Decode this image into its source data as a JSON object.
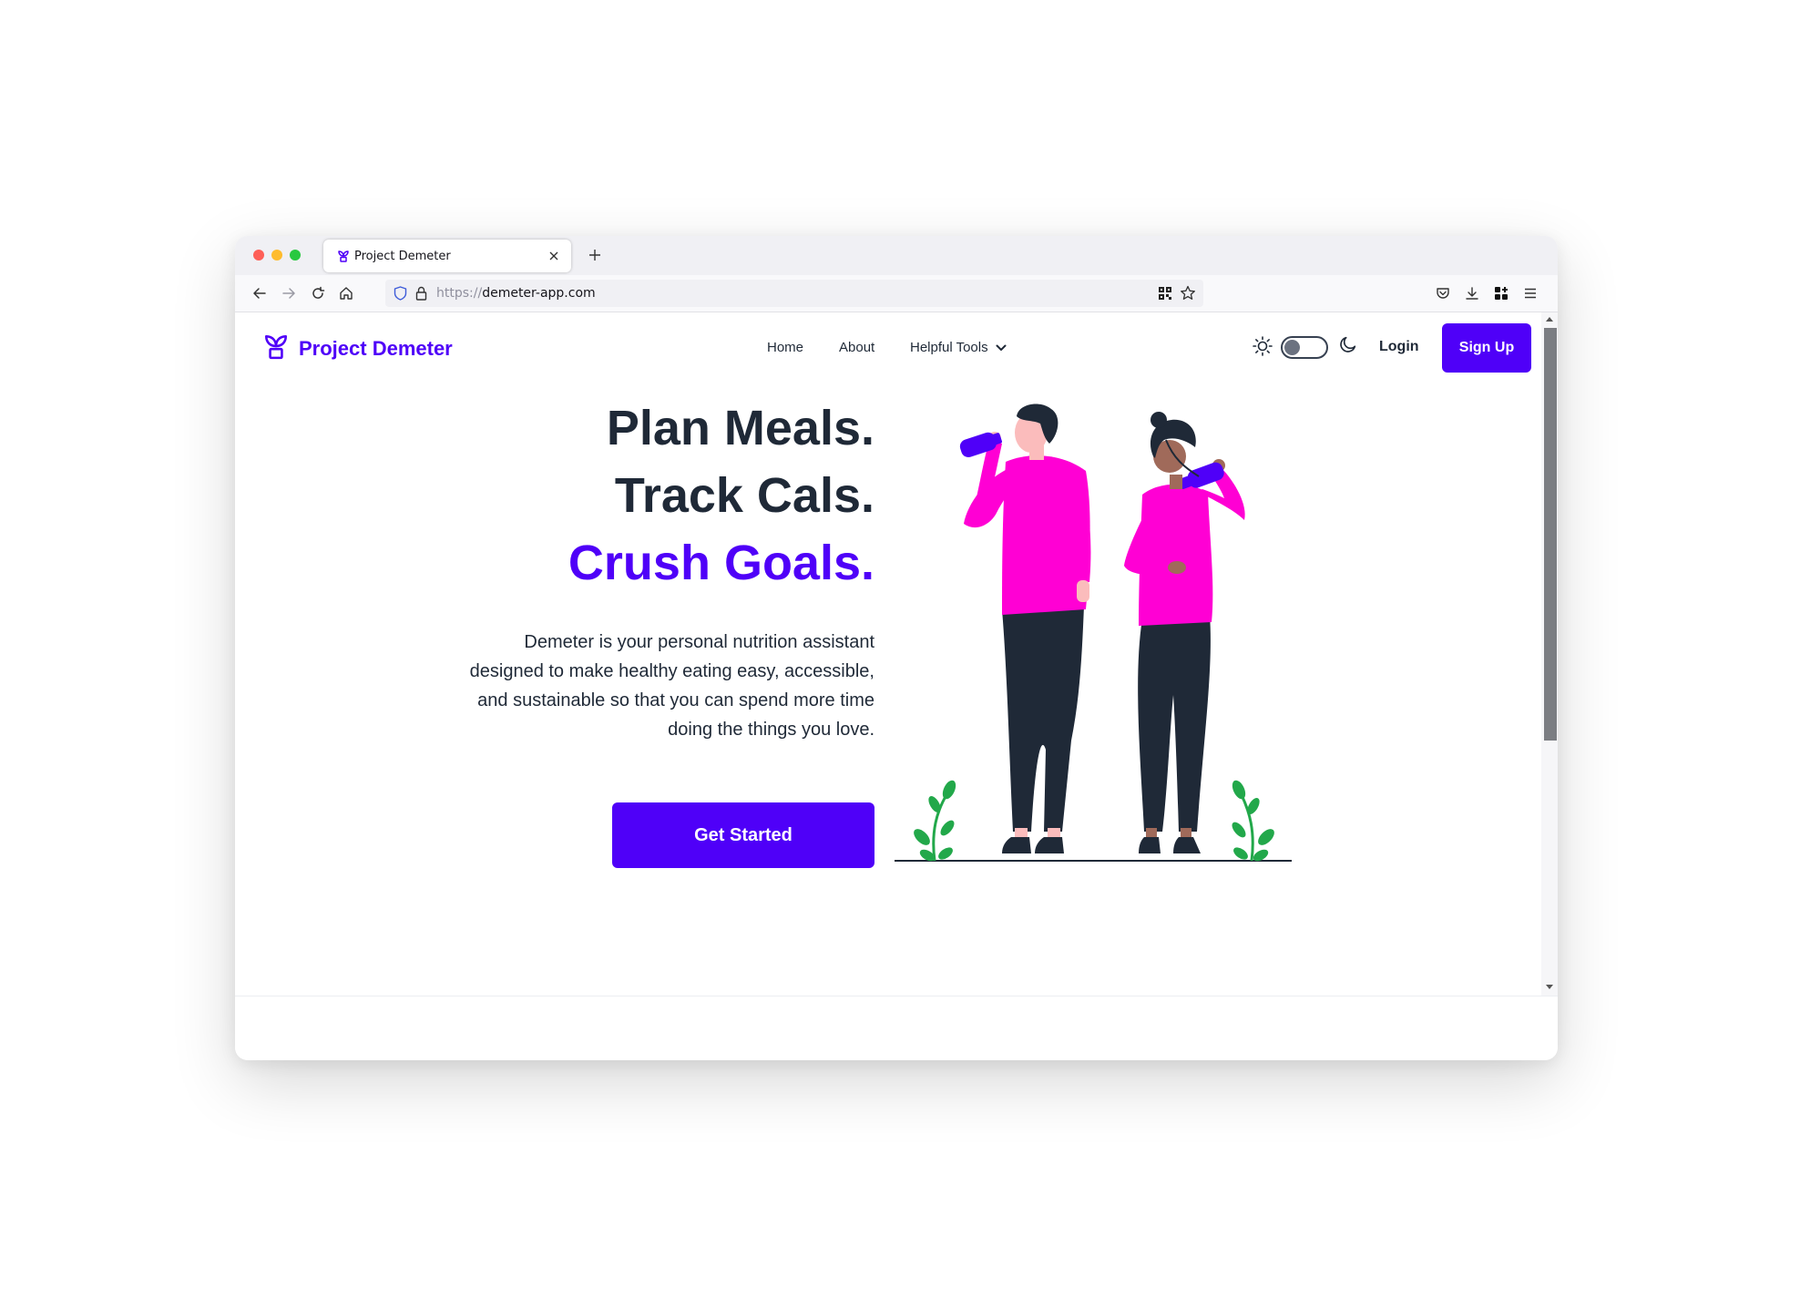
{
  "browser": {
    "tab_title": "Project Demeter",
    "url_scheme": "https://",
    "url_host": "demeter-app.com",
    "new_tab_label": "+"
  },
  "site": {
    "brand": "Project Demeter",
    "nav": {
      "home": "Home",
      "about": "About",
      "tools": "Helpful Tools"
    },
    "login": "Login",
    "signup": "Sign Up"
  },
  "hero": {
    "line1": "Plan Meals.",
    "line2": "Track Cals.",
    "line3": "Crush Goals.",
    "description": "Demeter is your personal nutrition assistant designed to make healthy eating easy, accessible, and sustainable so that you can spend more time doing the things you love.",
    "cta": "Get Started"
  },
  "theme_toggle": {
    "dark_mode": false
  },
  "colors": {
    "accent": "#4f00f8",
    "text_dark": "#1f2937",
    "illustration_magenta": "#ff00d4",
    "illustration_pants": "#1f2937",
    "plant_green": "#22a84a"
  },
  "icons": {
    "brand": "sprout-pot-icon",
    "tools_dropdown": "chevron-down-icon",
    "light_mode": "sun-icon",
    "dark_mode": "moon-icon"
  }
}
